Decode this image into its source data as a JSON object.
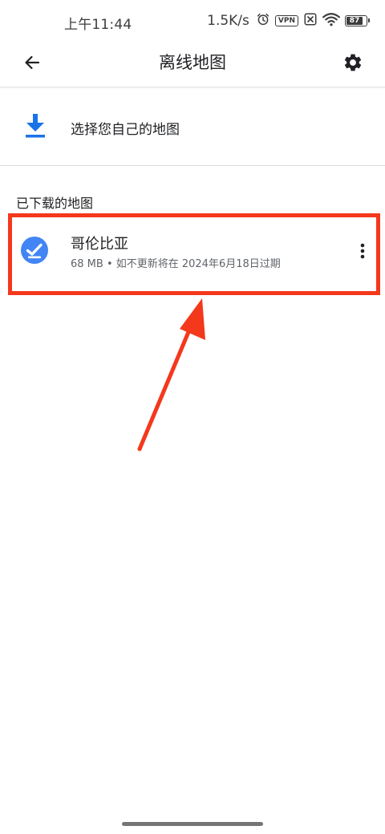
{
  "status_bar": {
    "time": "上午11:44",
    "net_speed": "1.5K/s",
    "vpn_label": "VPN",
    "battery_level": "87",
    "icons": [
      "alarm-icon",
      "vpn-icon",
      "sim-off-icon",
      "wifi-icon",
      "battery-icon"
    ]
  },
  "app_bar": {
    "title": "离线地图",
    "back_icon": "arrow-back-icon",
    "settings_icon": "gear-icon"
  },
  "select_own_map": {
    "label": "选择您自己的地图",
    "icon": "download-icon",
    "icon_color": "#1a73e8"
  },
  "downloaded_maps": {
    "section_title": "已下载的地图",
    "items": [
      {
        "name": "哥伦比亚",
        "details": "68 MB • 如不更新将在 2024年6月18日过期",
        "status_icon": "check-circle-icon",
        "status_color": "#4285f4",
        "menu_icon": "more-vert-icon"
      }
    ]
  },
  "annotation": {
    "highlight_color": "#f4381c",
    "arrow_color": "#f4381c"
  }
}
